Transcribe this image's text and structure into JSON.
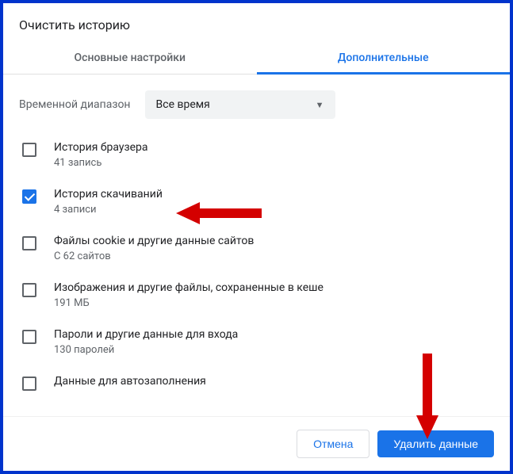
{
  "title": "Очистить историю",
  "tabs": {
    "basic": "Основные настройки",
    "advanced": "Дополнительные"
  },
  "time_range": {
    "label": "Временной диапазон",
    "value": "Все время"
  },
  "options": [
    {
      "title": "История браузера",
      "sub": "41 запись",
      "checked": false
    },
    {
      "title": "История скачиваний",
      "sub": "4 записи",
      "checked": true
    },
    {
      "title": "Файлы cookie и другие данные сайтов",
      "sub": "С 62 сайтов",
      "checked": false
    },
    {
      "title": "Изображения и другие файлы, сохраненные в кеше",
      "sub": "191 МБ",
      "checked": false
    },
    {
      "title": "Пароли и другие данные для входа",
      "sub": "130 паролей",
      "checked": false
    },
    {
      "title": "Данные для автозаполнения",
      "sub": "",
      "checked": false
    }
  ],
  "buttons": {
    "cancel": "Отмена",
    "delete": "Удалить данные"
  }
}
